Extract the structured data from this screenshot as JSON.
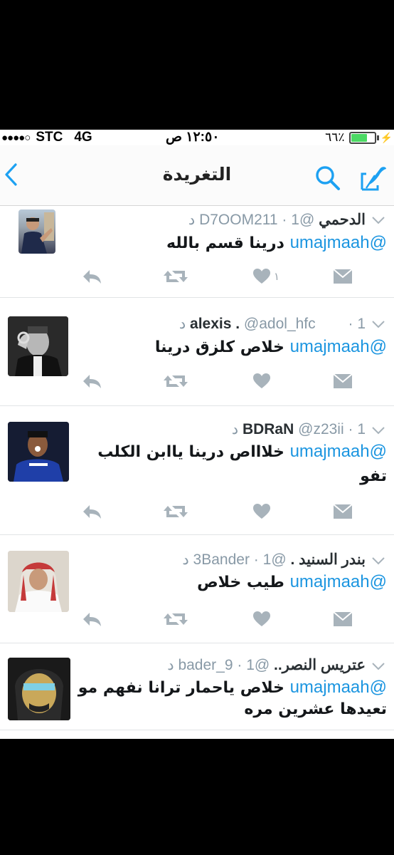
{
  "status_bar": {
    "signal_dots": "●●●●○",
    "carrier": "STC",
    "network": "4G",
    "time": "١٢:٥٠ ص",
    "battery_percent": "٦٦٪",
    "battery_level": 0.66
  },
  "nav": {
    "title": "التغريدة",
    "back_icon": "chevron-left-icon",
    "search_icon": "search-icon",
    "compose_icon": "compose-icon"
  },
  "colors": {
    "link": "#1b95e0",
    "muted": "#8899a6",
    "icon": "#a8b3bb"
  },
  "tweets": [
    {
      "name": "الدحمي",
      "handle": "@D7OOM211",
      "time": "1 د",
      "mention": "@umajmaah",
      "body": [
        "درينا قسم بالله"
      ],
      "like_count": "١"
    },
    {
      "name": "alexis .",
      "handle": "@adol_hfc",
      "time": "1 د",
      "mention": "@umajmaah",
      "body": [
        "خلاص كلزق درينا"
      ],
      "like_count": ""
    },
    {
      "name": "BDRaN",
      "handle": "@z23ii",
      "time": "1 د",
      "mention": "@umajmaah",
      "body": [
        "خلاااص درينا ياابن الكلب",
        "تفو"
      ],
      "like_count": ""
    },
    {
      "name": "بندر السنيد .",
      "handle": "@3Bander",
      "time": "1 د",
      "mention": "@umajmaah",
      "body": [
        "طيب خلاص"
      ],
      "like_count": ""
    },
    {
      "name": "عتريس النصر..",
      "handle": "@bader_9",
      "time": "1 د",
      "mention": "@umajmaah",
      "body": [
        "خلاص ياحمار ترانا نفهم مو",
        "تعيدها عشرين مره"
      ],
      "like_count": ""
    }
  ]
}
